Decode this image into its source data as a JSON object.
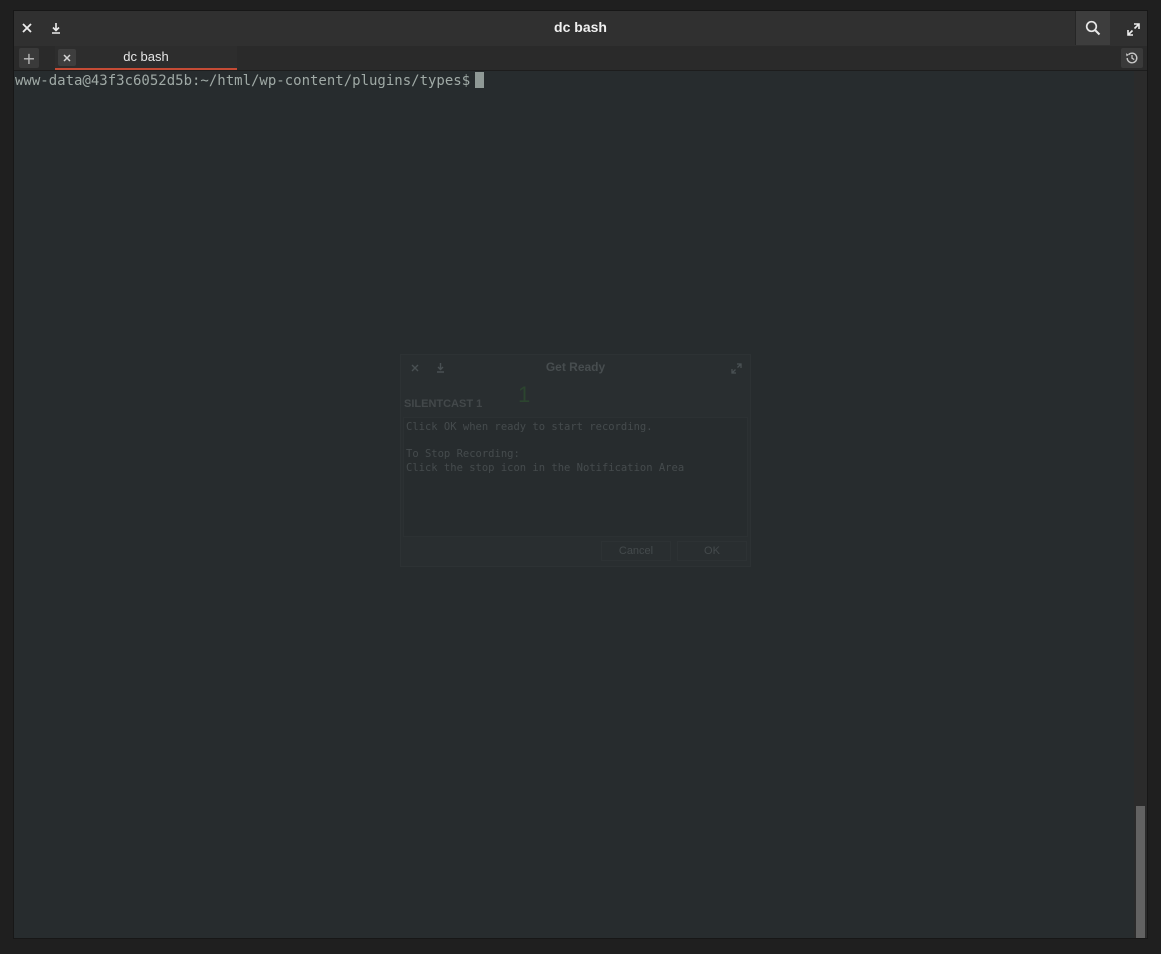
{
  "window": {
    "title": "dc bash",
    "close_icon": "close-icon",
    "minimize_icon": "download-arrow-icon",
    "search_icon": "search-icon",
    "maximize_icon": "expand-icon"
  },
  "tabs": {
    "new_tab_symbol": "+",
    "items": [
      {
        "label": "dc bash",
        "close_symbol": "×",
        "active": true
      }
    ],
    "history_icon": "history-icon",
    "active_underline_color": "#c54b35"
  },
  "terminal": {
    "prompt": "www-data@43f3c6052d5b:~/html/wp-content/plugins/types$",
    "background_color": "#272c2e",
    "text_color": "#a0aaa6"
  },
  "dialog": {
    "title": "Get Ready",
    "countdown": "1",
    "heading": "SILENTCAST 1",
    "body_lines": [
      "Click OK when ready to start recording.",
      "",
      "To Stop Recording:",
      "Click the stop icon in the Notification Area"
    ],
    "cancel_label": "Cancel",
    "ok_label": "OK"
  }
}
